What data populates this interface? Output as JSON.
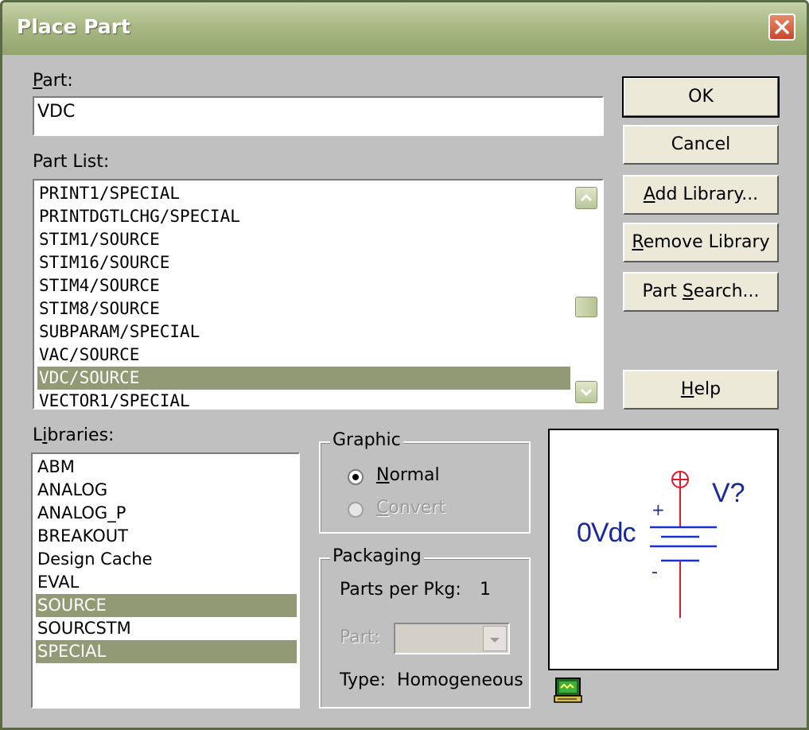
{
  "window": {
    "title": "Place Part"
  },
  "part": {
    "label": "Part:",
    "label_accel": "P",
    "label_rest": "art:",
    "value": "VDC"
  },
  "part_list": {
    "label": "Part List:",
    "items": [
      {
        "text": "PRINT1/SPECIAL",
        "selected": false
      },
      {
        "text": "PRINTDGTLCHG/SPECIAL",
        "selected": false
      },
      {
        "text": "STIM1/SOURCE",
        "selected": false
      },
      {
        "text": "STIM16/SOURCE",
        "selected": false
      },
      {
        "text": "STIM4/SOURCE",
        "selected": false
      },
      {
        "text": "STIM8/SOURCE",
        "selected": false
      },
      {
        "text": "SUBPARAM/SPECIAL",
        "selected": false
      },
      {
        "text": "VAC/SOURCE",
        "selected": false
      },
      {
        "text": "VDC/SOURCE",
        "selected": true
      },
      {
        "text": "VECTOR1/SPECIAL",
        "selected": false
      }
    ]
  },
  "libraries": {
    "label": "Libraries:",
    "label_pre": "L",
    "label_accel": "i",
    "label_rest": "braries:",
    "items": [
      {
        "text": "ABM",
        "selected": false
      },
      {
        "text": "ANALOG",
        "selected": false
      },
      {
        "text": "ANALOG_P",
        "selected": false
      },
      {
        "text": "BREAKOUT",
        "selected": false
      },
      {
        "text": "Design Cache",
        "selected": false
      },
      {
        "text": "EVAL",
        "selected": false
      },
      {
        "text": "SOURCE",
        "selected": true
      },
      {
        "text": "SOURCSTM",
        "selected": false
      },
      {
        "text": "SPECIAL",
        "selected": true
      }
    ]
  },
  "buttons": {
    "ok": "OK",
    "cancel": "Cancel",
    "add_library": {
      "accel": "A",
      "rest": "dd Library..."
    },
    "remove_library": {
      "accel": "R",
      "rest": "emove Library"
    },
    "part_search": {
      "pre": "Part ",
      "accel": "S",
      "rest": "earch..."
    },
    "help": {
      "accel": "H",
      "rest": "elp"
    }
  },
  "graphic": {
    "title": "Graphic",
    "normal": {
      "accel": "N",
      "rest": "ormal",
      "checked": true
    },
    "convert": {
      "accel": "C",
      "rest": "onvert",
      "checked": false,
      "disabled": true
    }
  },
  "packaging": {
    "title": "Packaging",
    "parts_per_pkg_label": "Parts per Pkg:",
    "parts_per_pkg_value": "1",
    "part_label": "Part:",
    "part_value": "",
    "type_label": "Type:",
    "type_value": "Homogeneous"
  },
  "preview": {
    "value_label": "0Vdc",
    "ref_label": "V?",
    "plus": "+",
    "minus": "-"
  },
  "colors": {
    "selection": "#919a74",
    "title_bar": "#a9b985",
    "symbol_red": "#e0162b",
    "symbol_blue": "#1a2fd0",
    "symbol_text": "#1b2a9a"
  },
  "icons": {
    "close": "close-x-icon",
    "scroll_up": "arrow-up-icon",
    "scroll_down": "arrow-down-icon",
    "combo": "chevron-down-icon",
    "preview_toggle": "schematic-monitor-icon"
  }
}
